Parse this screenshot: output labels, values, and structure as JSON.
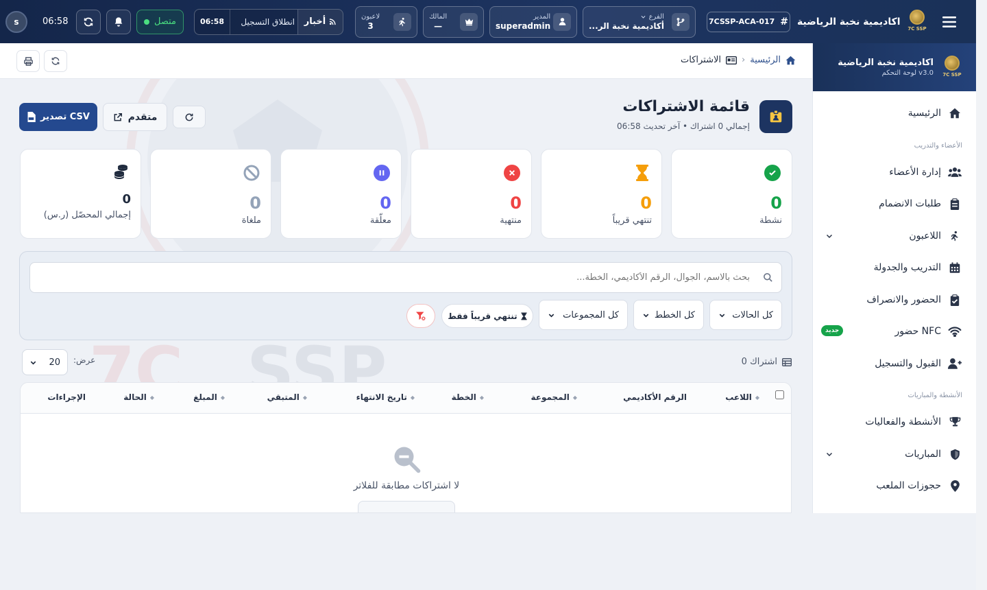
{
  "topbar": {
    "brand": "اكاديمية نخبة الرياضية",
    "logo_text": "7C SSP",
    "code": "7CSSP-ACA-017",
    "branch_label": "الفرع",
    "branch_value": "أكاديمية نخبة الر...",
    "manager_label": "المدير",
    "manager_value": "superadmin",
    "owner_label": "المالك",
    "owner_value": "—",
    "players_label": "لاعبون",
    "players_value": "3",
    "news_label": "أخبار",
    "ticker_text": "انطلاق التسجيل",
    "ticker_time": "06:58",
    "status_label": "متصل",
    "clock": "06:58",
    "avatar_letter": "s"
  },
  "breadcrumb": {
    "home": "الرئيسية",
    "current": "الاشتراكات"
  },
  "page": {
    "title": "قائمة الاشتراكات",
    "subtitle": "إجمالي 0 اشتراك • آخر تحديث 06:58",
    "export_label": "تصدير CSV",
    "advanced_label": "متقدم"
  },
  "stats": [
    {
      "label": "نشطة",
      "value": "0",
      "color": "#16a34a"
    },
    {
      "label": "تنتهي قريباً",
      "value": "0",
      "color": "#f59e0b"
    },
    {
      "label": "منتهية",
      "value": "0",
      "color": "#ef4444"
    },
    {
      "label": "معلّقة",
      "value": "0",
      "color": "#6366f1"
    },
    {
      "label": "ملغاة",
      "value": "0",
      "color": "#94a3b8"
    },
    {
      "label": "إجمالي المحصّل (ر.س)",
      "value": "0",
      "color": "#1f2a3d"
    }
  ],
  "filters": {
    "search_placeholder": "بحث بالاسم، الجوال، الرقم الأكاديمي، الخطة...",
    "status": "كل الحالات",
    "plans": "كل الخطط",
    "groups": "كل المجموعات",
    "expiring_only": "تنتهي قريباً فقط"
  },
  "table": {
    "count_label": "0 اشتراك",
    "show_label": "عرض:",
    "page_size": "20",
    "columns": [
      "اللاعب",
      "الرقم الأكاديمي",
      "المجموعة",
      "الخطة",
      "تاريخ الانتهاء",
      "المتبقي",
      "المبلغ",
      "الحالة",
      "الإجراءات"
    ],
    "empty_message": "لا اشتراكات مطابقة للفلاتر"
  },
  "sidebar": {
    "title": "اكاديمية نخبة الرياضية",
    "subtitle": "لوحة التحكم v3.0",
    "section_members": "الأعضاء والتدريب",
    "section_activities": "الأنشطة والمباريات",
    "new_badge": "جديد",
    "items": [
      {
        "label": "الرئيسية",
        "icon": "home-icon"
      },
      {
        "label": "إدارة الأعضاء",
        "icon": "users-icon"
      },
      {
        "label": "طلبات الانضمام",
        "icon": "clipboard-icon"
      },
      {
        "label": "اللاعبون",
        "icon": "runner-icon"
      },
      {
        "label": "التدريب والجدولة",
        "icon": "calendar-icon"
      },
      {
        "label": "الحضور والانصراف",
        "icon": "clipboard-check-icon"
      },
      {
        "label": "حضور NFC",
        "icon": "wifi-icon"
      },
      {
        "label": "القبول والتسجيل",
        "icon": "user-plus-icon"
      },
      {
        "label": "الأنشطة والفعاليات",
        "icon": "trophy-icon"
      },
      {
        "label": "المباريات",
        "icon": "shield-icon"
      },
      {
        "label": "حجوزات الملعب",
        "icon": "location-pin-icon"
      }
    ]
  }
}
